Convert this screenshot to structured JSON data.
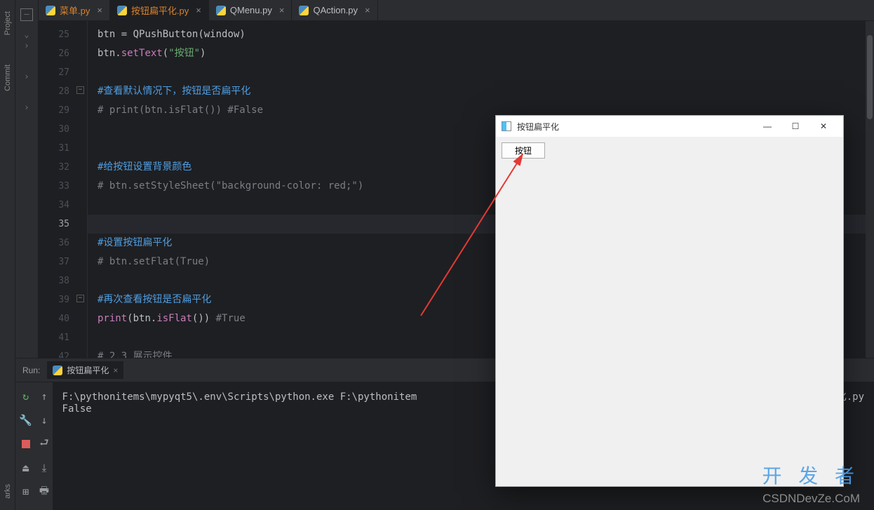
{
  "sidebar": {
    "project_label": "Project",
    "commit_label": "Commit",
    "bookmarks_label": "arks"
  },
  "tabs": [
    {
      "name": "菜单.py",
      "color": "orange",
      "active": false
    },
    {
      "name": "按钮扁平化.py",
      "color": "red",
      "active": true
    },
    {
      "name": "QMenu.py",
      "color": "",
      "active": false
    },
    {
      "name": "QAction.py",
      "color": "",
      "active": false
    }
  ],
  "code": {
    "lines": [
      {
        "n": 25,
        "tokens": [
          [
            "id",
            "btn"
          ],
          [
            "op",
            " = "
          ],
          [
            "cls",
            "QPushButton"
          ],
          [
            "op",
            "("
          ],
          [
            "id",
            "window"
          ],
          [
            "op",
            ")"
          ]
        ]
      },
      {
        "n": 26,
        "tokens": [
          [
            "id",
            "btn"
          ],
          [
            "op",
            "."
          ],
          [
            "fn",
            "setText"
          ],
          [
            "op",
            "("
          ],
          [
            "str",
            "\"按钮\""
          ],
          [
            "op",
            ")"
          ]
        ]
      },
      {
        "n": 27,
        "tokens": []
      },
      {
        "n": 28,
        "fold": true,
        "tokens": [
          [
            "cmt-cjk",
            "#查看默认情况下，按钮是否扁平化"
          ]
        ]
      },
      {
        "n": 29,
        "tokens": [
          [
            "cmt",
            "# print(btn.isFlat()) #False"
          ]
        ]
      },
      {
        "n": 30,
        "tokens": []
      },
      {
        "n": 31,
        "tokens": []
      },
      {
        "n": 32,
        "tokens": [
          [
            "cmt-cjk",
            "#给按钮设置背景颜色"
          ]
        ]
      },
      {
        "n": 33,
        "tokens": [
          [
            "cmt",
            "# btn.setStyleSheet(\"background-color: red;\")"
          ]
        ]
      },
      {
        "n": 34,
        "tokens": []
      },
      {
        "n": 35,
        "current": true,
        "tokens": []
      },
      {
        "n": 36,
        "tokens": [
          [
            "cmt-cjk",
            "#设置按钮扁平化"
          ]
        ]
      },
      {
        "n": 37,
        "tokens": [
          [
            "cmt",
            "# btn.setFlat(True)"
          ]
        ]
      },
      {
        "n": 38,
        "tokens": []
      },
      {
        "n": 39,
        "fold": true,
        "tokens": [
          [
            "cmt-cjk",
            "#再次查看按钮是否扁平化"
          ]
        ]
      },
      {
        "n": 40,
        "tokens": [
          [
            "fn",
            "print"
          ],
          [
            "op",
            "("
          ],
          [
            "id",
            "btn"
          ],
          [
            "op",
            "."
          ],
          [
            "fn",
            "isFlat"
          ],
          [
            "op",
            "())"
          ],
          [
            "cmt",
            " #True"
          ]
        ]
      },
      {
        "n": 41,
        "tokens": []
      },
      {
        "n": 42,
        "tokens": [
          [
            "cmt",
            "# 2.3 展示控件"
          ]
        ]
      }
    ]
  },
  "run": {
    "label": "Run:",
    "tab_name": "按钮扁平化",
    "output_line1": "F:\\pythonitems\\mypyqt5\\.env\\Scripts\\python.exe F:\\pythonitem                                                                       化.py",
    "output_line2": "False"
  },
  "app_window": {
    "title": "按钮扁平化",
    "button_text": "按钮"
  },
  "watermarks": {
    "w1": "开 发 者",
    "w2": "CSDNDevZe.CoM"
  }
}
